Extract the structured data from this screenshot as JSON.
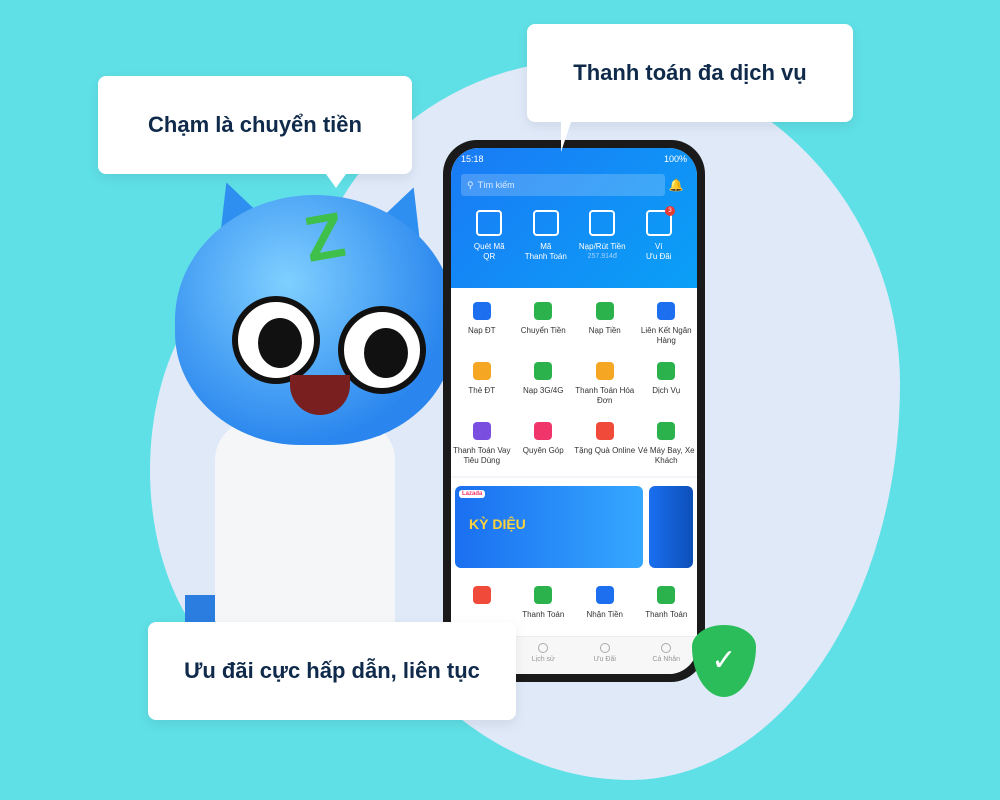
{
  "callouts": {
    "top_left": "Chạm là chuyển tiền",
    "top_right": "Thanh toán đa dịch vụ",
    "bottom_left": "Ưu đãi cực hấp dẫn, liên tục"
  },
  "status_bar": {
    "time": "15:18",
    "battery": "100%"
  },
  "search": {
    "placeholder": "Tìm kiếm"
  },
  "quick_actions": [
    {
      "label1": "Quét Mã",
      "label2": "QR",
      "icon": "qr-scan-icon"
    },
    {
      "label1": "Mã",
      "label2": "Thanh Toán",
      "icon": "qr-code-icon"
    },
    {
      "label1": "Nạp/Rút Tiền",
      "label2": "257.914đ",
      "icon": "wallet-icon"
    },
    {
      "label1": "Ví",
      "label2": "Ưu Đãi",
      "icon": "voucher-wallet-icon",
      "badge": "3"
    }
  ],
  "services": [
    {
      "label": "Nạp ĐT",
      "color": "#1e6ff0"
    },
    {
      "label": "Chuyển Tiền",
      "color": "#2bb24c"
    },
    {
      "label": "Nạp Tiền",
      "color": "#2bb24c"
    },
    {
      "label": "Liên Kết Ngân Hàng",
      "color": "#1e6ff0"
    },
    {
      "label": "Thẻ ĐT",
      "color": "#f5a623"
    },
    {
      "label": "Nạp 3G/4G",
      "color": "#2bb24c"
    },
    {
      "label": "Thanh Toán Hóa Đơn",
      "color": "#f5a623"
    },
    {
      "label": "Dịch Vụ",
      "color": "#2bb24c"
    },
    {
      "label": "Thanh Toán Vay Tiêu Dùng",
      "color": "#7a4fe0"
    },
    {
      "label": "Quyên Góp",
      "color": "#f0356b"
    },
    {
      "label": "Tặng Quà Online",
      "color": "#f04a3a"
    },
    {
      "label": "Vé Máy Bay, Xe Khách",
      "color": "#2bb24c"
    }
  ],
  "banner": {
    "brand": "Lazada",
    "headline": "KỲ DIỆU"
  },
  "services_row2": [
    {
      "label": "",
      "color": "#f04a3a"
    },
    {
      "label": "Thanh Toán",
      "color": "#2bb24c"
    },
    {
      "label": "Nhận Tiền",
      "color": "#1e6ff0"
    },
    {
      "label": "Thanh Toán",
      "color": "#2bb24c"
    }
  ],
  "bottom_nav": [
    {
      "label": "Lịch sử"
    },
    {
      "label": "Ưu Đãi"
    },
    {
      "label": "Cá Nhân"
    }
  ],
  "colors": {
    "background": "#5fe0e6",
    "app_blue": "#1a7af5",
    "shield": "#2bbd59"
  }
}
